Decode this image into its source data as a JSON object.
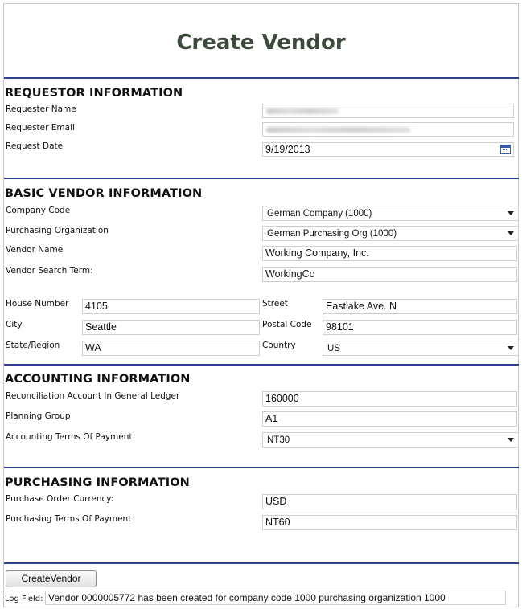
{
  "title": "Create Vendor",
  "requestor": {
    "heading": "REQUESTOR INFORMATION",
    "name_label": "Requester Name",
    "email_label": "Requester Email",
    "date_label": "Request Date",
    "date_value": "9/19/2013"
  },
  "basic": {
    "heading": "BASIC VENDOR INFORMATION",
    "company_code_label": "Company Code",
    "company_code_value": "German Company (1000)",
    "purch_org_label": "Purchasing Organization",
    "purch_org_value": "German Purchasing Org (1000)",
    "vendor_name_label": "Vendor Name",
    "vendor_name_value": "Working Company, Inc.",
    "search_term_label": "Vendor Search Term:",
    "search_term_value": "WorkingCo",
    "house_number_label": "House Number",
    "house_number_value": "4105",
    "street_label": "Street",
    "street_value": "Eastlake Ave. N",
    "city_label": "City",
    "city_value": "Seattle",
    "postal_code_label": "Postal Code",
    "postal_code_value": "98101",
    "state_label": "State/Region",
    "state_value": "WA",
    "country_label": "Country",
    "country_value": "US"
  },
  "accounting": {
    "heading": "ACCOUNTING INFORMATION",
    "recon_label": "Reconciliation Account In General Ledger",
    "recon_value": "160000",
    "planning_label": "Planning Group",
    "planning_value": "A1",
    "terms_label": "Accounting Terms Of Payment",
    "terms_value": "NT30"
  },
  "purchasing": {
    "heading": "PURCHASING INFORMATION",
    "currency_label": "Purchase Order Currency:",
    "currency_value": "USD",
    "terms_label": "Purchasing Terms Of Payment",
    "terms_value": "NT60"
  },
  "actions": {
    "create_label": "CreateVendor",
    "log_label": "Log Field:",
    "log_value": "Vendor 0000005772 has been created for company code 1000 purchasing organization 1000"
  },
  "colors": {
    "title": "#3b4a3a",
    "rule": "#2f3f8f",
    "field_border": "#cfcfcf"
  },
  "icons": [
    "calendar-icon",
    "chevron-down-icon"
  ]
}
